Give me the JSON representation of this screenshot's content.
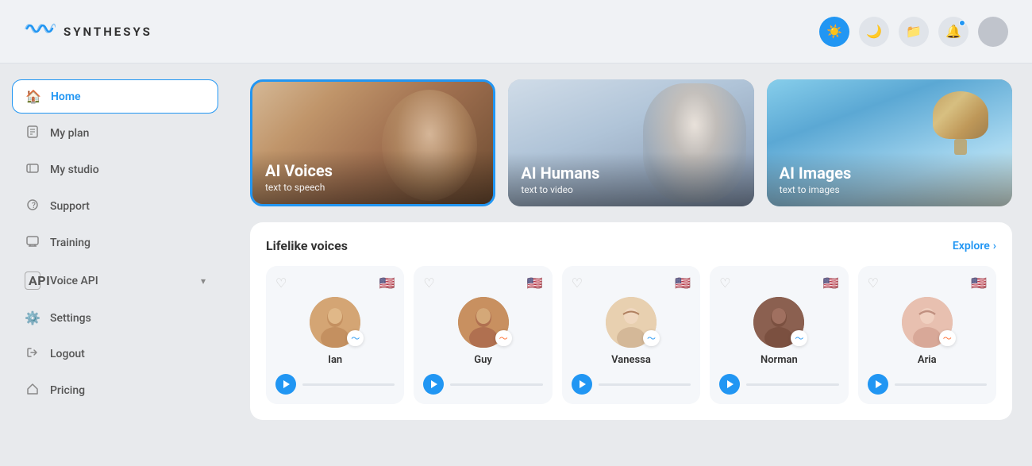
{
  "header": {
    "logo_text": "SYNTHESYS",
    "icons": {
      "theme_light": "☀",
      "theme_dark": "🌙",
      "folder": "📁",
      "bell": "🔔"
    }
  },
  "sidebar": {
    "items": [
      {
        "id": "home",
        "label": "Home",
        "icon": "🏠",
        "active": true
      },
      {
        "id": "my-plan",
        "label": "My plan",
        "icon": "📄",
        "active": false
      },
      {
        "id": "my-studio",
        "label": "My studio",
        "icon": "📁",
        "active": false
      },
      {
        "id": "support",
        "label": "Support",
        "icon": "❓",
        "active": false
      },
      {
        "id": "training",
        "label": "Training",
        "icon": "🖥",
        "active": false
      },
      {
        "id": "voice-api",
        "label": "Voice API",
        "icon": "API",
        "active": false,
        "has_chevron": true
      },
      {
        "id": "settings",
        "label": "Settings",
        "icon": "⚙",
        "active": false
      },
      {
        "id": "logout",
        "label": "Logout",
        "icon": "↗",
        "active": false
      },
      {
        "id": "pricing",
        "label": "Pricing",
        "icon": "🏷",
        "active": false
      }
    ]
  },
  "categories": [
    {
      "id": "ai-voices",
      "title": "AI Voices",
      "subtitle": "text to speech",
      "selected": true
    },
    {
      "id": "ai-humans",
      "title": "AI Humans",
      "subtitle": "text to video",
      "selected": false
    },
    {
      "id": "ai-images",
      "title": "AI Images",
      "subtitle": "text to images",
      "selected": false
    }
  ],
  "voices_section": {
    "title": "Lifelike voices",
    "explore_label": "Explore",
    "explore_arrow": "›",
    "voices": [
      {
        "id": "ian",
        "name": "Ian",
        "wave_color": "blue",
        "flag": "🇺🇸"
      },
      {
        "id": "guy",
        "name": "Guy",
        "wave_color": "orange",
        "flag": "🇺🇸"
      },
      {
        "id": "vanessa",
        "name": "Vanessa",
        "wave_color": "blue",
        "flag": "🇺🇸"
      },
      {
        "id": "norman",
        "name": "Norman",
        "wave_color": "blue",
        "flag": "🇺🇸"
      },
      {
        "id": "aria",
        "name": "Aria",
        "wave_color": "orange",
        "flag": "🇺🇸"
      }
    ]
  }
}
